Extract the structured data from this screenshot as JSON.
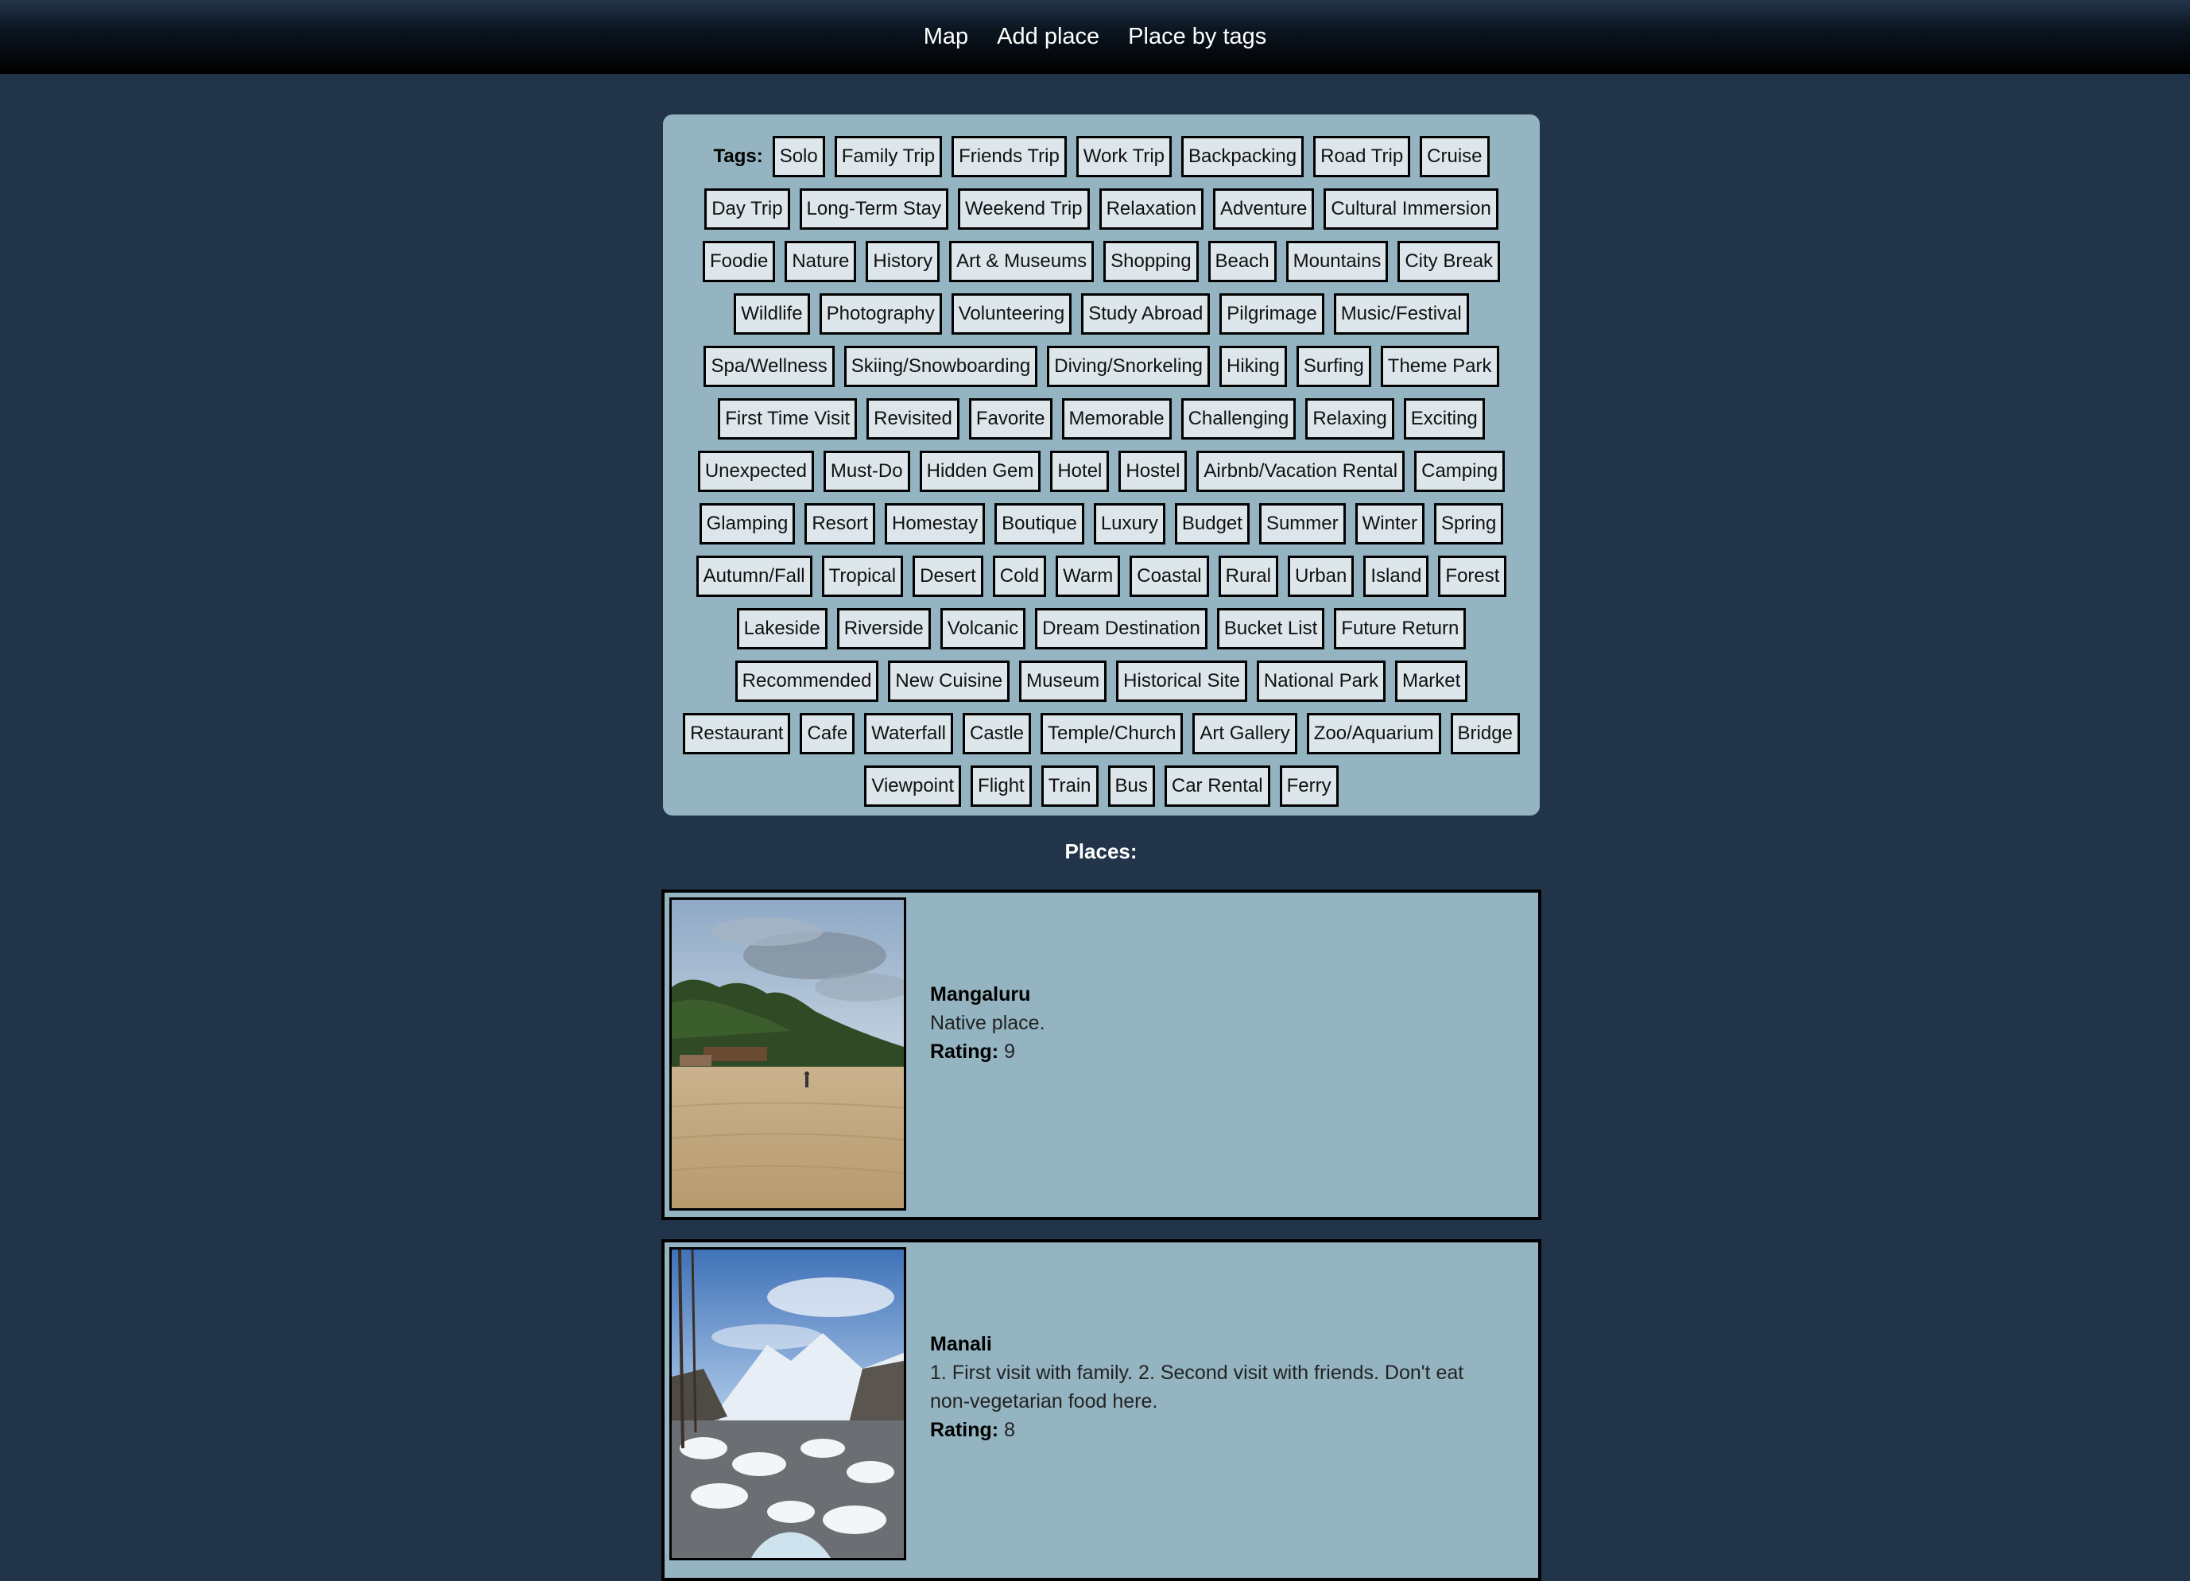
{
  "nav": {
    "links": [
      "Map",
      "Add place",
      "Place by tags"
    ]
  },
  "tags": {
    "label": "Tags:",
    "rows": [
      [
        "Solo",
        "Family Trip",
        "Friends Trip",
        "Work Trip",
        "Backpacking",
        "Road Trip",
        "Cruise"
      ],
      [
        "Day Trip",
        "Long-Term Stay",
        "Weekend Trip",
        "Relaxation",
        "Adventure",
        "Cultural Immersion"
      ],
      [
        "Foodie",
        "Nature",
        "History",
        "Art & Museums",
        "Shopping",
        "Beach",
        "Mountains",
        "City Break"
      ],
      [
        "Wildlife",
        "Photography",
        "Volunteering",
        "Study Abroad",
        "Pilgrimage",
        "Music/Festival"
      ],
      [
        "Spa/Wellness",
        "Skiing/Snowboarding",
        "Diving/Snorkeling",
        "Hiking",
        "Surfing",
        "Theme Park"
      ],
      [
        "First Time Visit",
        "Revisited",
        "Favorite",
        "Memorable",
        "Challenging",
        "Relaxing",
        "Exciting"
      ],
      [
        "Unexpected",
        "Must-Do",
        "Hidden Gem",
        "Hotel",
        "Hostel",
        "Airbnb/Vacation Rental",
        "Camping"
      ],
      [
        "Glamping",
        "Resort",
        "Homestay",
        "Boutique",
        "Luxury",
        "Budget",
        "Summer",
        "Winter",
        "Spring"
      ],
      [
        "Autumn/Fall",
        "Tropical",
        "Desert",
        "Cold",
        "Warm",
        "Coastal",
        "Rural",
        "Urban",
        "Island",
        "Forest"
      ],
      [
        "Lakeside",
        "Riverside",
        "Volcanic",
        "Dream Destination",
        "Bucket List",
        "Future Return"
      ],
      [
        "Recommended",
        "New Cuisine",
        "Museum",
        "Historical Site",
        "National Park",
        "Market"
      ],
      [
        "Restaurant",
        "Cafe",
        "Waterfall",
        "Castle",
        "Temple/Church",
        "Art Gallery",
        "Zoo/Aquarium",
        "Bridge"
      ],
      [
        "Viewpoint",
        "Flight",
        "Train",
        "Bus",
        "Car Rental",
        "Ferry"
      ]
    ]
  },
  "places": {
    "heading": "Places:",
    "rating_label": "Rating:",
    "items": [
      {
        "name": "Mangaluru",
        "description": "Native place.",
        "rating": "9",
        "image": "beach-photo"
      },
      {
        "name": "Manali",
        "description": "1. First visit with family. 2. Second visit with friends. Don't eat non-vegetarian food here.",
        "rating": "8",
        "image": "snowy-mountain-river-photo"
      }
    ]
  }
}
